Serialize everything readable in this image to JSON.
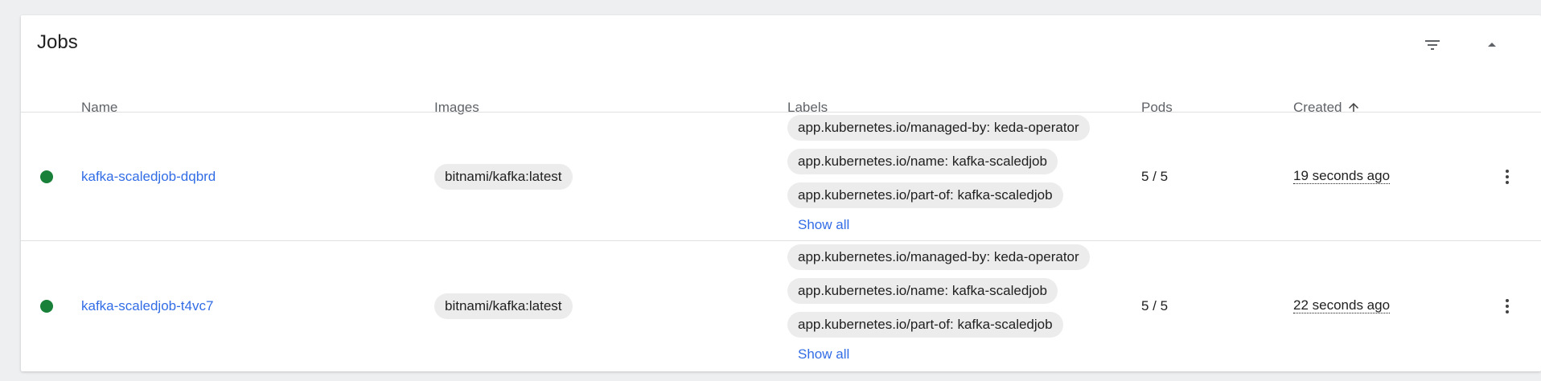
{
  "card": {
    "title": "Jobs",
    "filter_icon": "filter-list-icon",
    "collapse_icon": "arrow-drop-up-icon"
  },
  "table": {
    "columns": {
      "name": "Name",
      "images": "Images",
      "labels": "Labels",
      "pods": "Pods",
      "created": "Created"
    },
    "sort_icon": "arrow-upward-icon",
    "rows": [
      {
        "status_color": "#188038",
        "name": "kafka-scaledjob-dqbrd",
        "image": "bitnami/kafka:latest",
        "labels": [
          "app.kubernetes.io/managed-by: keda-operator",
          "app.kubernetes.io/name: kafka-scaledjob",
          "app.kubernetes.io/part-of: kafka-scaledjob"
        ],
        "show_all": "Show all",
        "pods": "5 / 5",
        "created": "19 seconds ago"
      },
      {
        "status_color": "#188038",
        "name": "kafka-scaledjob-t4vc7",
        "image": "bitnami/kafka:latest",
        "labels": [
          "app.kubernetes.io/managed-by: keda-operator",
          "app.kubernetes.io/name: kafka-scaledjob",
          "app.kubernetes.io/part-of: kafka-scaledjob"
        ],
        "show_all": "Show all",
        "pods": "5 / 5",
        "created": "22 seconds ago"
      }
    ]
  }
}
